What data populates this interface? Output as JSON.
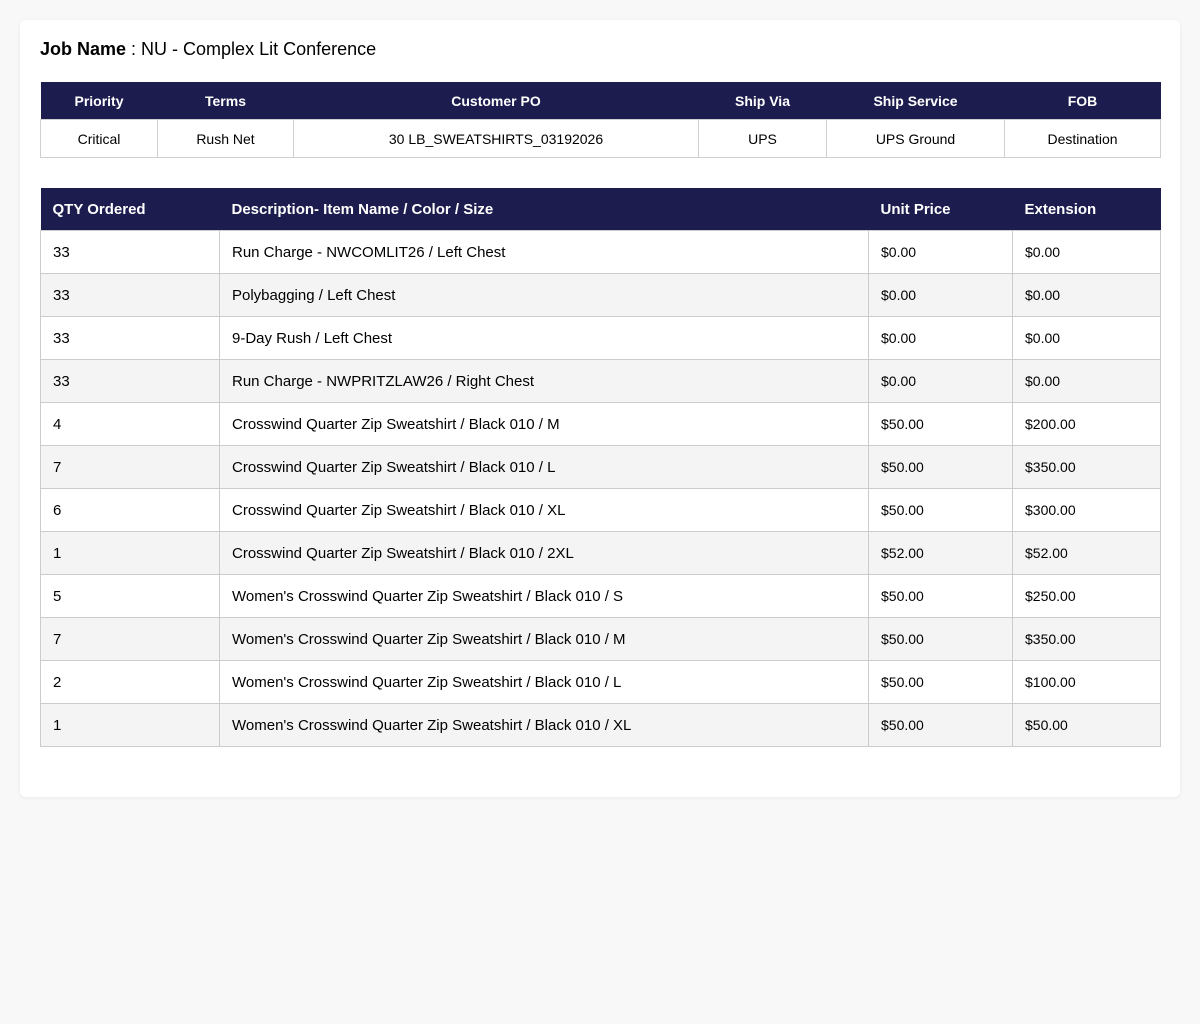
{
  "job": {
    "label": "Job Name",
    "separator": " : ",
    "value": "NU - Complex Lit Conference"
  },
  "order_info": {
    "headers": [
      "Priority",
      "Terms",
      "Customer PO",
      "Ship Via",
      "Ship Service",
      "FOB"
    ],
    "values": [
      "Critical",
      "Rush Net",
      "30 LB_SWEATSHIRTS_03192026",
      "UPS",
      "UPS Ground",
      "Destination"
    ]
  },
  "line_items": {
    "headers": [
      "QTY Ordered",
      "Description- Item Name / Color / Size",
      "Unit Price",
      "Extension"
    ],
    "rows": [
      {
        "qty": "33",
        "description": "Run Charge - NWCOMLIT26 / Left Chest",
        "unit_price": "$0.00",
        "extension": "$0.00"
      },
      {
        "qty": "33",
        "description": "Polybagging / Left Chest",
        "unit_price": "$0.00",
        "extension": "$0.00"
      },
      {
        "qty": "33",
        "description": "9-Day Rush / Left Chest",
        "unit_price": "$0.00",
        "extension": "$0.00"
      },
      {
        "qty": "33",
        "description": "Run Charge - NWPRITZLAW26 / Right Chest",
        "unit_price": "$0.00",
        "extension": "$0.00"
      },
      {
        "qty": "4",
        "description": "Crosswind Quarter Zip Sweatshirt / Black 010 / M",
        "unit_price": "$50.00",
        "extension": "$200.00"
      },
      {
        "qty": "7",
        "description": "Crosswind Quarter Zip Sweatshirt / Black 010 / L",
        "unit_price": "$50.00",
        "extension": "$350.00"
      },
      {
        "qty": "6",
        "description": "Crosswind Quarter Zip Sweatshirt / Black 010 / XL",
        "unit_price": "$50.00",
        "extension": "$300.00"
      },
      {
        "qty": "1",
        "description": "Crosswind Quarter Zip Sweatshirt / Black 010 / 2XL",
        "unit_price": "$52.00",
        "extension": "$52.00"
      },
      {
        "qty": "5",
        "description": "Women's Crosswind Quarter Zip Sweatshirt / Black 010 / S",
        "unit_price": "$50.00",
        "extension": "$250.00"
      },
      {
        "qty": "7",
        "description": "Women's Crosswind Quarter Zip Sweatshirt / Black 010 / M",
        "unit_price": "$50.00",
        "extension": "$350.00"
      },
      {
        "qty": "2",
        "description": "Women's Crosswind Quarter Zip Sweatshirt / Black 010 / L",
        "unit_price": "$50.00",
        "extension": "$100.00"
      },
      {
        "qty": "1",
        "description": "Women's Crosswind Quarter Zip Sweatshirt / Black 010 / XL",
        "unit_price": "$50.00",
        "extension": "$50.00"
      }
    ]
  },
  "colors": {
    "header_bg": "#1c1c4e",
    "header_text": "#ffffff",
    "zebra_row": "#f4f4f4",
    "page_bg": "#f8f8f8"
  }
}
